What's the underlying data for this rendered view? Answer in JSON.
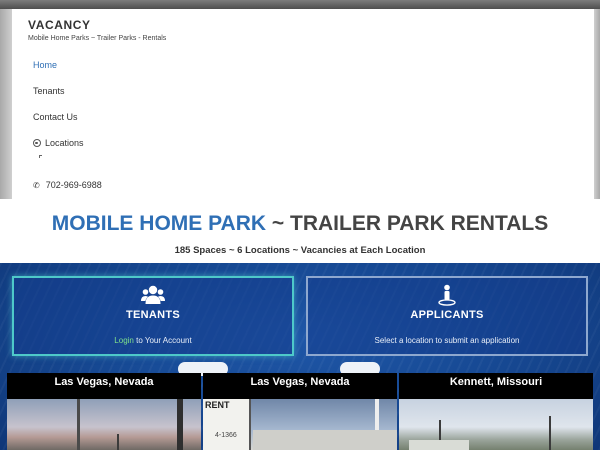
{
  "site": {
    "title": "VACANCY",
    "tagline": "Mobile Home Parks ~ Trailer Parks - Rentals"
  },
  "nav": {
    "home": "Home",
    "tenants": "Tenants",
    "contact": "Contact Us",
    "locations": "Locations",
    "phone": "702-969-6988"
  },
  "banner": {
    "title_accent": "MOBILE HOME PARK",
    "title_rest": " ~ TRAILER PARK RENTALS",
    "subtitle": "185 Spaces ~ 6 Locations ~ Vacancies at Each Location"
  },
  "tenants_box": {
    "title": "TENANTS",
    "login_link": "Login",
    "text_after_link": " to Your Account",
    "icon": "users-icon"
  },
  "applicants_box": {
    "title": "APPLICANTS",
    "text": "Select a location to submit an application",
    "icon": "person-pin-icon"
  },
  "locations": [
    {
      "name": "Las Vegas, Nevada"
    },
    {
      "name": "Las Vegas, Nevada",
      "sign_text": "RENT",
      "sign_number": "4-1366"
    },
    {
      "name": "Kennett, Missouri"
    }
  ],
  "colors": {
    "accent_blue": "#2f6fb5",
    "panel_blue": "#174a95",
    "tenants_border": "#4ec9c9",
    "login_green": "#7fe08a"
  }
}
